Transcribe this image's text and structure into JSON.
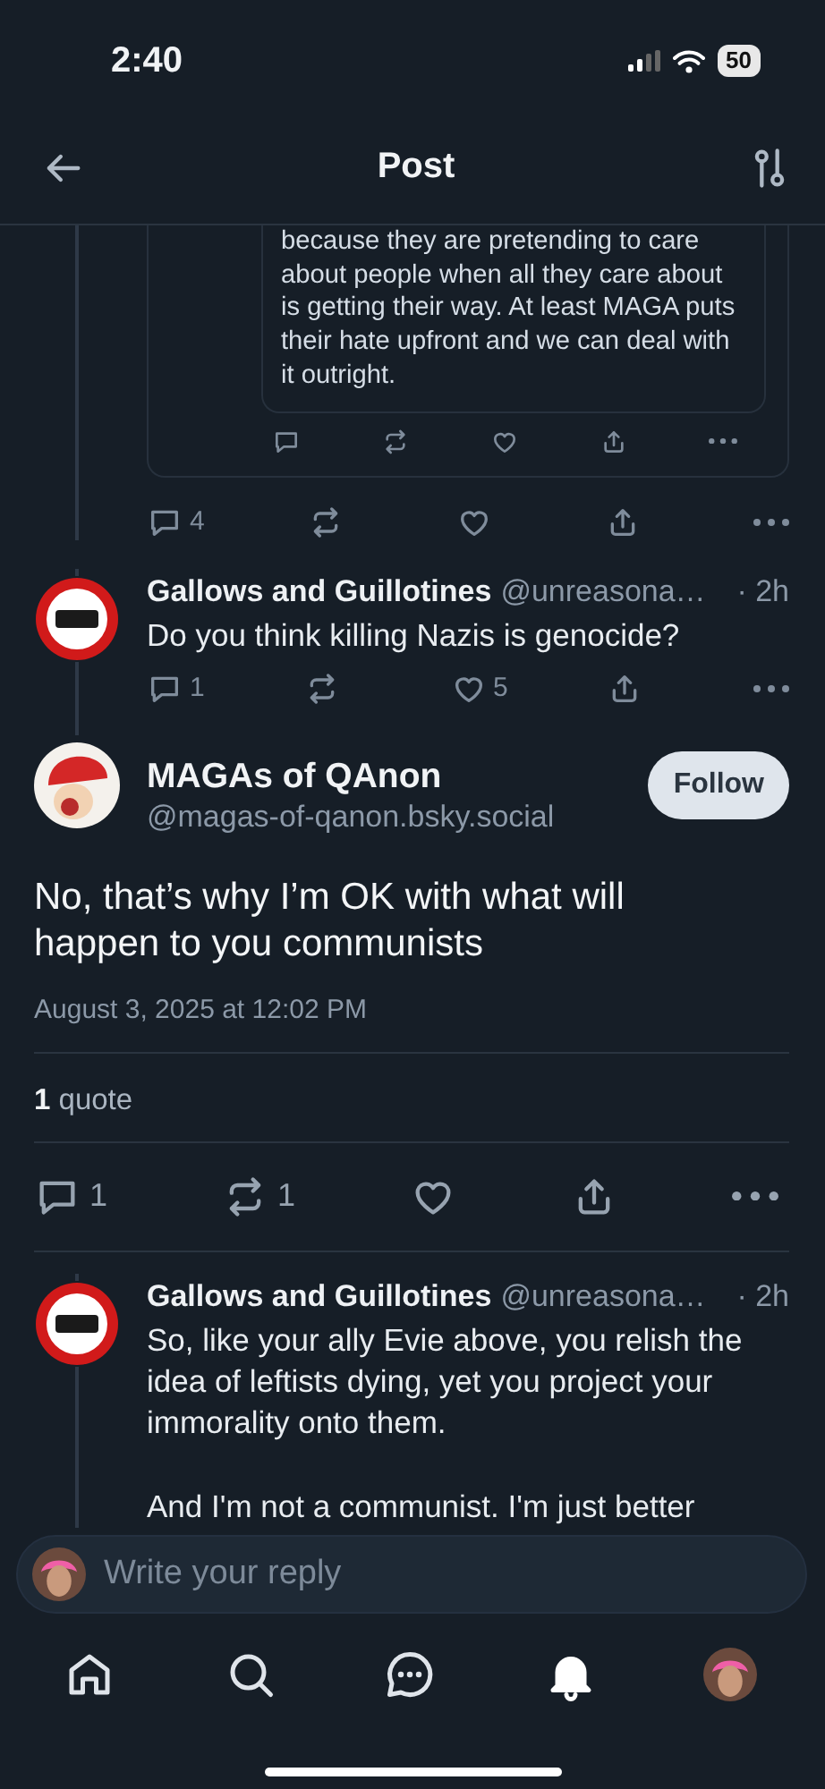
{
  "status_bar": {
    "time": "2:40",
    "battery": "50"
  },
  "header": {
    "title": "Post"
  },
  "parent_post": {
    "quote": {
      "text": "because they are pretending to care about people when all they care about is getting their way. At least MAGA puts their hate upfront and we can deal with it outright.",
      "actions": [
        {
          "kind": "reply"
        },
        {
          "kind": "repost"
        },
        {
          "kind": "like"
        },
        {
          "kind": "share"
        },
        {
          "kind": "more"
        }
      ]
    },
    "actions": [
      {
        "kind": "reply",
        "count": "4"
      },
      {
        "kind": "repost"
      },
      {
        "kind": "like"
      },
      {
        "kind": "share"
      },
      {
        "kind": "more"
      }
    ]
  },
  "replies_above": [
    {
      "name": "Gallows and Guillotines",
      "handle": "@unreasona…",
      "time": "· 2h",
      "text": "Do you think killing Nazis is genocide?",
      "actions": [
        {
          "kind": "reply",
          "count": "1"
        },
        {
          "kind": "repost"
        },
        {
          "kind": "like",
          "count": "5"
        },
        {
          "kind": "share"
        },
        {
          "kind": "more"
        }
      ]
    }
  ],
  "focused_post": {
    "name": "MAGAs of QAnon",
    "handle": "@magas-of-qanon.bsky.social",
    "follow": "Follow",
    "text": "No, that’s why I’m OK with what will happen to you communists",
    "date": "August 3, 2025 at 12:02 PM",
    "quote_stat": "**1** quote",
    "actions": [
      {
        "kind": "reply",
        "count": "1"
      },
      {
        "kind": "repost",
        "count": "1"
      },
      {
        "kind": "like"
      },
      {
        "kind": "share"
      },
      {
        "kind": "more"
      }
    ]
  },
  "replies": [
    {
      "name": "Gallows and Guillotines",
      "handle": "@unreasona…",
      "time": "· 2h",
      "text": "So, like your ally Evie above, you relish the idea of leftists dying, yet you project your immorality onto them.\n\nAnd I'm not a communist. I'm just better"
    }
  ],
  "composer": {
    "placeholder": "Write your reply"
  },
  "nav": [
    {
      "kind": "home",
      "selected": false
    },
    {
      "kind": "search",
      "selected": false
    },
    {
      "kind": "chat",
      "selected": false
    },
    {
      "kind": "notifications",
      "selected": true
    },
    {
      "kind": "profile",
      "selected": false
    }
  ]
}
